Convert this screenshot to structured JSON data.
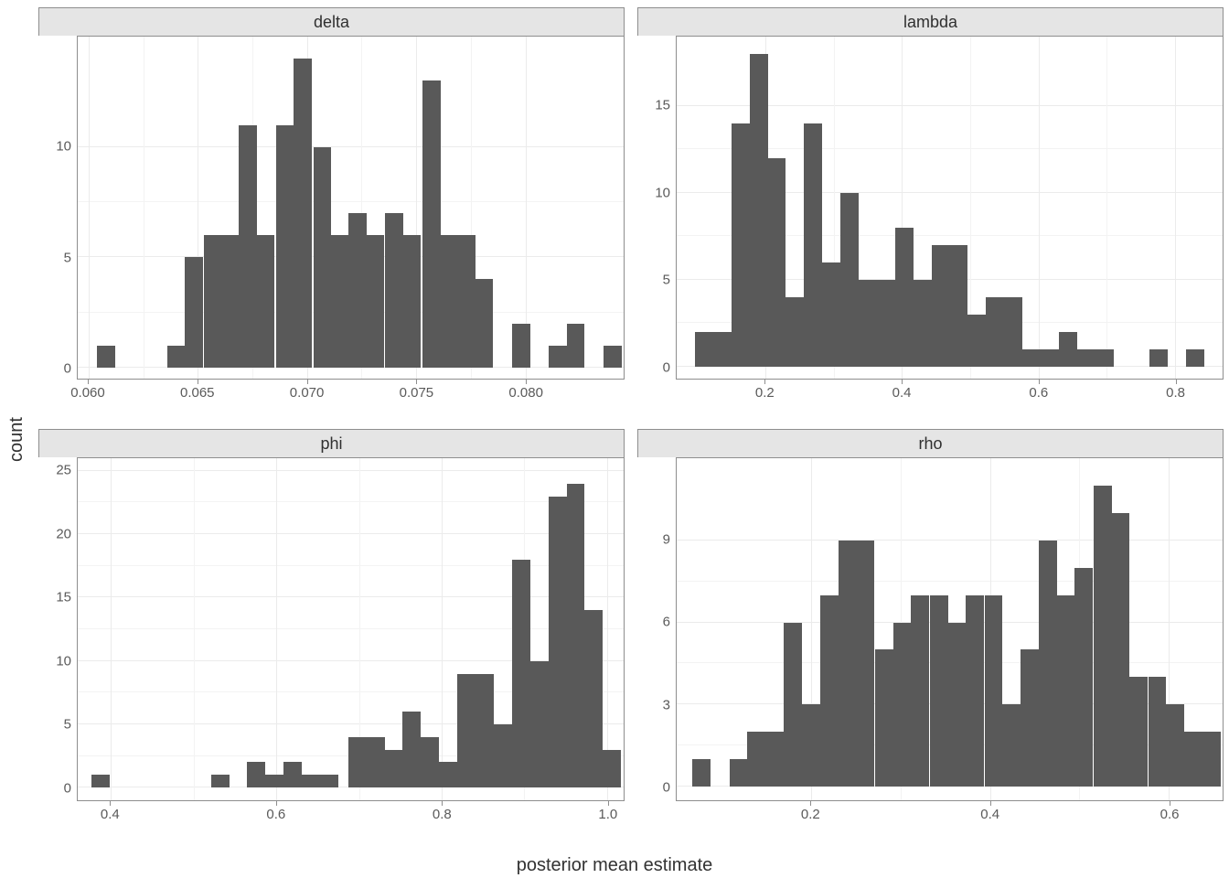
{
  "xlabel": "posterior mean estimate",
  "ylabel": "count",
  "chart_data": [
    {
      "title": "delta",
      "type": "bar",
      "xlim": [
        0.0595,
        0.0845
      ],
      "ylim": [
        -0.5,
        15
      ],
      "yticks": [
        0,
        5,
        10
      ],
      "xticks": [
        0.06,
        0.065,
        0.07,
        0.075,
        0.08
      ],
      "xtick_labels": [
        "0.060",
        "0.065",
        "0.070",
        "0.075",
        "0.080"
      ],
      "binwidth": 0.0008333,
      "bins": [
        {
          "x": 0.0608,
          "c": 1
        },
        {
          "x": 0.064,
          "c": 1
        },
        {
          "x": 0.0648,
          "c": 5
        },
        {
          "x": 0.0657,
          "c": 6
        },
        {
          "x": 0.0665,
          "c": 6
        },
        {
          "x": 0.0673,
          "c": 11
        },
        {
          "x": 0.0681,
          "c": 6
        },
        {
          "x": 0.069,
          "c": 11
        },
        {
          "x": 0.0698,
          "c": 14
        },
        {
          "x": 0.0707,
          "c": 10
        },
        {
          "x": 0.0715,
          "c": 6
        },
        {
          "x": 0.0723,
          "c": 7
        },
        {
          "x": 0.0731,
          "c": 6
        },
        {
          "x": 0.074,
          "c": 7
        },
        {
          "x": 0.0748,
          "c": 6
        },
        {
          "x": 0.0757,
          "c": 13
        },
        {
          "x": 0.0765,
          "c": 6
        },
        {
          "x": 0.0773,
          "c": 6
        },
        {
          "x": 0.0781,
          "c": 4
        },
        {
          "x": 0.0798,
          "c": 2
        },
        {
          "x": 0.0815,
          "c": 1
        },
        {
          "x": 0.0823,
          "c": 2
        },
        {
          "x": 0.084,
          "c": 1
        }
      ]
    },
    {
      "title": "lambda",
      "type": "bar",
      "xlim": [
        0.07,
        0.87
      ],
      "ylim": [
        -0.7,
        19
      ],
      "yticks": [
        0,
        5,
        10,
        15
      ],
      "xticks": [
        0.2,
        0.4,
        0.6,
        0.8
      ],
      "xtick_labels": [
        "0.2",
        "0.4",
        "0.6",
        "0.8"
      ],
      "binwidth": 0.0267,
      "bins": [
        {
          "x": 0.11,
          "c": 2
        },
        {
          "x": 0.1367,
          "c": 2
        },
        {
          "x": 0.1633,
          "c": 14
        },
        {
          "x": 0.19,
          "c": 18
        },
        {
          "x": 0.2167,
          "c": 12
        },
        {
          "x": 0.2433,
          "c": 4
        },
        {
          "x": 0.27,
          "c": 14
        },
        {
          "x": 0.2967,
          "c": 6
        },
        {
          "x": 0.3233,
          "c": 10
        },
        {
          "x": 0.35,
          "c": 5
        },
        {
          "x": 0.3767,
          "c": 5
        },
        {
          "x": 0.4033,
          "c": 8
        },
        {
          "x": 0.43,
          "c": 5
        },
        {
          "x": 0.4567,
          "c": 7
        },
        {
          "x": 0.4833,
          "c": 7
        },
        {
          "x": 0.51,
          "c": 3
        },
        {
          "x": 0.5367,
          "c": 4
        },
        {
          "x": 0.5633,
          "c": 4
        },
        {
          "x": 0.59,
          "c": 1
        },
        {
          "x": 0.6167,
          "c": 1
        },
        {
          "x": 0.6433,
          "c": 2
        },
        {
          "x": 0.67,
          "c": 1
        },
        {
          "x": 0.6967,
          "c": 1
        },
        {
          "x": 0.7767,
          "c": 1
        },
        {
          "x": 0.83,
          "c": 1
        }
      ]
    },
    {
      "title": "phi",
      "type": "bar",
      "xlim": [
        0.36,
        1.02
      ],
      "ylim": [
        -1,
        26
      ],
      "yticks": [
        0,
        5,
        10,
        15,
        20,
        25
      ],
      "xticks": [
        0.4,
        0.6,
        0.8,
        1.0
      ],
      "xtick_labels": [
        "0.4",
        "0.6",
        "0.8",
        "1.0"
      ],
      "binwidth": 0.022,
      "bins": [
        {
          "x": 0.388,
          "c": 1
        },
        {
          "x": 0.532,
          "c": 1
        },
        {
          "x": 0.576,
          "c": 2
        },
        {
          "x": 0.598,
          "c": 1
        },
        {
          "x": 0.62,
          "c": 2
        },
        {
          "x": 0.642,
          "c": 1
        },
        {
          "x": 0.664,
          "c": 1
        },
        {
          "x": 0.698,
          "c": 4
        },
        {
          "x": 0.72,
          "c": 4
        },
        {
          "x": 0.742,
          "c": 3
        },
        {
          "x": 0.764,
          "c": 6
        },
        {
          "x": 0.786,
          "c": 4
        },
        {
          "x": 0.808,
          "c": 2
        },
        {
          "x": 0.83,
          "c": 9
        },
        {
          "x": 0.852,
          "c": 9
        },
        {
          "x": 0.874,
          "c": 5
        },
        {
          "x": 0.896,
          "c": 18
        },
        {
          "x": 0.918,
          "c": 10
        },
        {
          "x": 0.94,
          "c": 23
        },
        {
          "x": 0.962,
          "c": 24
        },
        {
          "x": 0.984,
          "c": 14
        },
        {
          "x": 1.006,
          "c": 3
        }
      ]
    },
    {
      "title": "rho",
      "type": "bar",
      "xlim": [
        0.05,
        0.66
      ],
      "ylim": [
        -0.5,
        12
      ],
      "yticks": [
        0,
        3,
        6,
        9
      ],
      "xticks": [
        0.2,
        0.4,
        0.6
      ],
      "xtick_labels": [
        "0.2",
        "0.4",
        "0.6"
      ],
      "binwidth": 0.02033,
      "bins": [
        {
          "x": 0.078,
          "c": 1
        },
        {
          "x": 0.119,
          "c": 1
        },
        {
          "x": 0.139,
          "c": 2
        },
        {
          "x": 0.159,
          "c": 2
        },
        {
          "x": 0.18,
          "c": 6
        },
        {
          "x": 0.2,
          "c": 3
        },
        {
          "x": 0.221,
          "c": 7
        },
        {
          "x": 0.241,
          "c": 9
        },
        {
          "x": 0.261,
          "c": 9
        },
        {
          "x": 0.282,
          "c": 5
        },
        {
          "x": 0.302,
          "c": 6
        },
        {
          "x": 0.322,
          "c": 7
        },
        {
          "x": 0.343,
          "c": 7
        },
        {
          "x": 0.363,
          "c": 6
        },
        {
          "x": 0.383,
          "c": 7
        },
        {
          "x": 0.404,
          "c": 7
        },
        {
          "x": 0.424,
          "c": 3
        },
        {
          "x": 0.444,
          "c": 5
        },
        {
          "x": 0.465,
          "c": 9
        },
        {
          "x": 0.485,
          "c": 7
        },
        {
          "x": 0.505,
          "c": 8
        },
        {
          "x": 0.526,
          "c": 11
        },
        {
          "x": 0.546,
          "c": 10
        },
        {
          "x": 0.566,
          "c": 4
        },
        {
          "x": 0.587,
          "c": 4
        },
        {
          "x": 0.607,
          "c": 3
        },
        {
          "x": 0.627,
          "c": 2
        },
        {
          "x": 0.648,
          "c": 2
        }
      ]
    }
  ]
}
